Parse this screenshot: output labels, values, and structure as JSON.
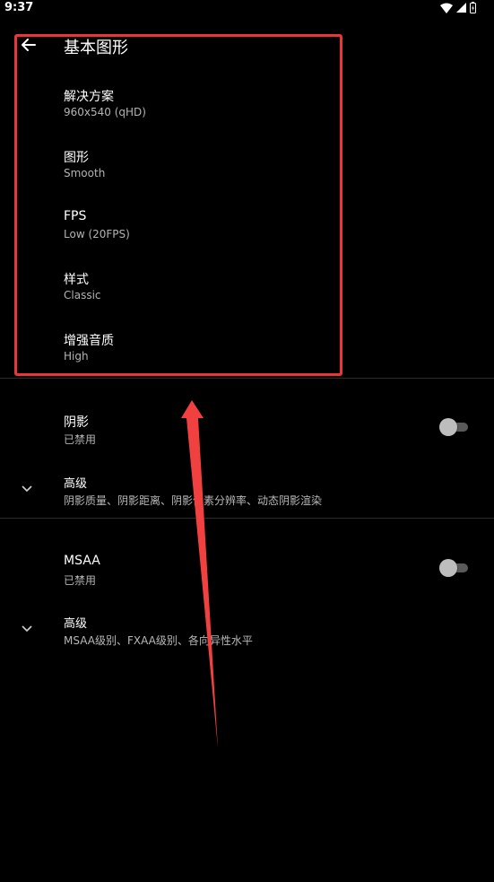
{
  "status_bar": {
    "time": "9:37",
    "icons": [
      "wifi-icon",
      "signal-icon",
      "battery-icon"
    ]
  },
  "app_bar": {
    "title": "基本图形",
    "back_icon": "arrow-left-icon"
  },
  "basic_settings": [
    {
      "title": "解决方案",
      "summary": "960x540 (qHD)"
    },
    {
      "title": "图形",
      "summary": "Smooth"
    },
    {
      "title": "FPS",
      "summary": "Low (20FPS)"
    },
    {
      "title": "样式",
      "summary": "Classic"
    },
    {
      "title": "增强音质",
      "summary": "High"
    }
  ],
  "shadow_section": {
    "title": "阴影",
    "summary": "已禁用",
    "enabled": false,
    "advanced": {
      "title": "高级",
      "summary": "阴影质量、阴影距离、阴影像素分辨率、动态阴影渲染"
    }
  },
  "msaa_section": {
    "title": "MSAA",
    "summary": "已禁用",
    "enabled": false,
    "advanced": {
      "title": "高级",
      "summary": "MSAA级别、FXAA级别、各向异性水平"
    }
  },
  "annotation": {
    "highlight_color": "#e8363a",
    "arrow_color": "#f04040"
  }
}
